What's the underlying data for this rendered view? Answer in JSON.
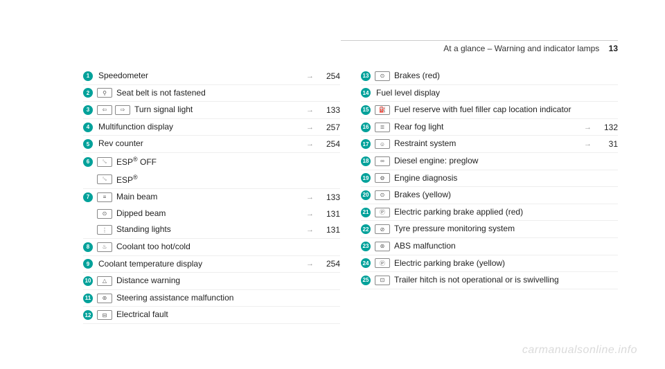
{
  "header": {
    "title": "At a glance – Warning and indicator lamps",
    "page": "13"
  },
  "left": [
    {
      "num": "1",
      "syms": [],
      "label": "Speedometer",
      "pg": "254",
      "border": true
    },
    {
      "num": "2",
      "syms": [
        "⚲"
      ],
      "label": "Seat belt is not fastened",
      "pg": "",
      "border": true
    },
    {
      "num": "3",
      "syms": [
        "⇦",
        "⇨"
      ],
      "label": "Turn signal light",
      "pg": "133",
      "border": true
    },
    {
      "num": "4",
      "syms": [],
      "label": "Multifunction display",
      "pg": "257",
      "border": true
    },
    {
      "num": "5",
      "syms": [],
      "label": "Rev counter",
      "pg": "254",
      "border": true
    },
    {
      "num": "6",
      "syms": [
        "␚"
      ],
      "label": "ESP® OFF",
      "pg": "",
      "border": false
    },
    {
      "num": "",
      "syms": [
        "␚"
      ],
      "label": "ESP®",
      "pg": "",
      "border": true
    },
    {
      "num": "7",
      "syms": [
        "≡"
      ],
      "label": "Main beam",
      "pg": "133",
      "border": false
    },
    {
      "num": "",
      "syms": [
        "⊙"
      ],
      "label": "Dipped beam",
      "pg": "131",
      "border": false
    },
    {
      "num": "",
      "syms": [
        "⋮"
      ],
      "label": "Standing lights",
      "pg": "131",
      "border": true
    },
    {
      "num": "8",
      "syms": [
        "♨"
      ],
      "label": "Coolant too hot/cold",
      "pg": "",
      "border": true
    },
    {
      "num": "9",
      "syms": [],
      "label": "Coolant temperature display",
      "pg": "254",
      "border": true
    },
    {
      "num": "10",
      "syms": [
        "△"
      ],
      "label": "Distance warning",
      "pg": "",
      "border": true
    },
    {
      "num": "11",
      "syms": [
        "⊚"
      ],
      "label": "Steering assistance malfunction",
      "pg": "",
      "border": true
    },
    {
      "num": "12",
      "syms": [
        "⊟"
      ],
      "label": "Electrical fault",
      "pg": "",
      "border": true
    }
  ],
  "right": [
    {
      "num": "13",
      "syms": [
        "⊙"
      ],
      "label": "Brakes (red)",
      "pg": "",
      "border": true
    },
    {
      "num": "14",
      "syms": [],
      "label": "Fuel level display",
      "pg": "",
      "border": true
    },
    {
      "num": "15",
      "syms": [
        "⛽"
      ],
      "label": "Fuel reserve with fuel filler cap location indicator",
      "pg": "",
      "border": true
    },
    {
      "num": "16",
      "syms": [
        "≣"
      ],
      "label": "Rear fog light",
      "pg": "132",
      "border": true
    },
    {
      "num": "17",
      "syms": [
        "☺"
      ],
      "label": "Restraint system",
      "pg": "31",
      "border": true
    },
    {
      "num": "18",
      "syms": [
        "∞"
      ],
      "label": "Diesel engine: preglow",
      "pg": "",
      "border": true
    },
    {
      "num": "19",
      "syms": [
        "⚙"
      ],
      "label": "Engine diagnosis",
      "pg": "",
      "border": true
    },
    {
      "num": "20",
      "syms": [
        "⊙"
      ],
      "label": "Brakes (yellow)",
      "pg": "",
      "border": true
    },
    {
      "num": "21",
      "syms": [
        "Ⓟ"
      ],
      "label": "Electric parking brake applied (red)",
      "pg": "",
      "border": true
    },
    {
      "num": "22",
      "syms": [
        "⊘"
      ],
      "label": "Tyre pressure monitoring system",
      "pg": "",
      "border": true
    },
    {
      "num": "23",
      "syms": [
        "⊛"
      ],
      "label": "ABS malfunction",
      "pg": "",
      "border": true
    },
    {
      "num": "24",
      "syms": [
        "Ⓟ"
      ],
      "label": "Electric parking brake (yellow)",
      "pg": "",
      "border": true
    },
    {
      "num": "25",
      "syms": [
        "⊡"
      ],
      "label": "Trailer hitch is not operational or is swivelling",
      "pg": "",
      "border": true
    }
  ],
  "watermark": "carmanualsonline.info"
}
